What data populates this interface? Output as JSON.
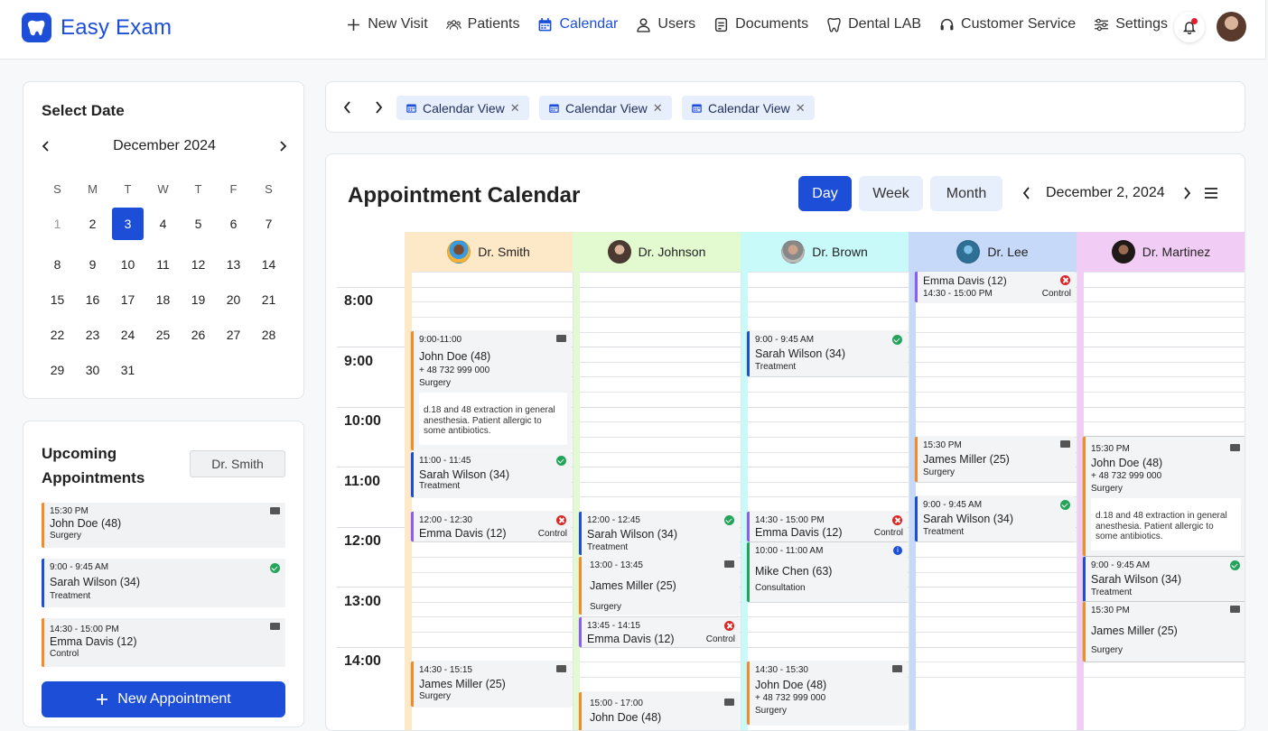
{
  "app": {
    "name": "Easy Exam"
  },
  "nav": [
    {
      "label": "New Visit",
      "icon": "plus-icon"
    },
    {
      "label": "Patients",
      "icon": "patients-icon"
    },
    {
      "label": "Calendar",
      "icon": "calendar-icon",
      "active": true
    },
    {
      "label": "Users",
      "icon": "user-icon"
    },
    {
      "label": "Documents",
      "icon": "document-icon"
    },
    {
      "label": "Dental LAB",
      "icon": "tooth-icon"
    },
    {
      "label": "Customer Service",
      "icon": "headset-icon"
    },
    {
      "label": "Settings",
      "icon": "sliders-icon"
    }
  ],
  "colors": {
    "accent": "#1d4ed8",
    "orange": "#f28c28",
    "blue": "#1d4ed8",
    "purple": "#8b5cf6",
    "green": "#22a559",
    "red": "#dc2626"
  },
  "date_picker": {
    "title": "Select Date",
    "month": "December 2024",
    "day_headers": [
      "S",
      "M",
      "T",
      "W",
      "T",
      "F",
      "S"
    ],
    "days": [
      "1",
      "2",
      "3",
      "4",
      "5",
      "6",
      "7",
      "8",
      "9",
      "10",
      "11",
      "12",
      "13",
      "14",
      "15",
      "16",
      "17",
      "18",
      "19",
      "20",
      "21",
      "22",
      "23",
      "24",
      "25",
      "26",
      "27",
      "28",
      "29",
      "30",
      "31"
    ],
    "selected": "3"
  },
  "upcoming": {
    "title": "Upcoming Appointments",
    "filter": "Dr. Smith",
    "items": [
      {
        "time": "15:30 PM",
        "name": "John Doe (48)",
        "type": "Surgery",
        "status": "mail"
      },
      {
        "time": "9:00 - 9:45 AM",
        "name": "Sarah Wilson (34)",
        "type": "Treatment",
        "status": "confirmed"
      },
      {
        "time": "14:30 - 15:00 PM",
        "name": "Emma Davis (12)",
        "type": "Control",
        "status": "mail"
      }
    ],
    "new_button": "New Appointment"
  },
  "tabs": [
    {
      "label": "Calendar View"
    },
    {
      "label": "Calendar View"
    },
    {
      "label": "Calendar View"
    }
  ],
  "calendar": {
    "title": "Appointment Calendar",
    "views": [
      "Day",
      "Week",
      "Month"
    ],
    "active_view": "Day",
    "date": "December 2, 2024",
    "hours": [
      "8:00",
      "9:00",
      "10:00",
      "11:00",
      "12:00",
      "13:00",
      "14:00"
    ],
    "doctors": [
      {
        "name": "Dr. Smith",
        "bg": "#fde9c7",
        "strip": "#fde9c7"
      },
      {
        "name": "Dr. Johnson",
        "bg": "#e3f9d0",
        "strip": "#e3f9d0"
      },
      {
        "name": "Dr. Brown",
        "bg": "#c9fafa",
        "strip": "#c9fafa"
      },
      {
        "name": "Dr. Lee",
        "bg": "#c6d9f8",
        "strip": "#c6d9f8"
      },
      {
        "name": "Dr. Martinez",
        "bg": "#f1cdf5",
        "strip": "#f1cdf5"
      }
    ],
    "events": {
      "smith_1": {
        "time": "9:00-11:00",
        "name": "John Doe (48)",
        "phone": "+ 48 732 999 000",
        "type": "Surgery",
        "note": "d.18 and 48 extraction in general anesthesia. Patient allergic to some antibiotics."
      },
      "smith_2": {
        "time": "11:00 - 11:45",
        "name": "Sarah Wilson (34)",
        "type": "Treatment"
      },
      "smith_3": {
        "time": "12:00 - 12:30",
        "name": "Emma Davis (12)",
        "type": "Control"
      },
      "smith_4": {
        "time": "14:30 - 15:15",
        "name": "James Miller (25)",
        "type": "Surgery"
      },
      "johnson_1": {
        "time": "12:00 - 12:45",
        "name": "Sarah Wilson (34)",
        "type": "Treatment"
      },
      "johnson_2": {
        "time": "13:00 - 13:45",
        "name": "James Miller (25)",
        "type": "Surgery"
      },
      "johnson_3": {
        "time": "13:45 - 14:15",
        "name": "Emma Davis (12)",
        "type": "Control"
      },
      "johnson_4": {
        "time": "15:00 - 17:00",
        "name": "John Doe (48)"
      },
      "brown_1": {
        "time": "9:00 - 9:45 AM",
        "name": "Sarah Wilson (34)",
        "type": "Treatment"
      },
      "brown_2": {
        "time": "14:30 - 15:00 PM",
        "name": "Emma Davis (12)",
        "type": "Control"
      },
      "brown_3": {
        "time": "10:00 - 11:00 AM",
        "name": "Mike Chen (63)",
        "type": "Consultation"
      },
      "brown_4": {
        "time": "14:30 - 15:30",
        "name": "John Doe (48)",
        "phone": "+ 48 732 999 000",
        "type": "Surgery"
      },
      "lee_1": {
        "name": "Emma Davis (12)",
        "time": "14:30 - 15:00 PM",
        "type": "Control"
      },
      "lee_2": {
        "time": "15:30 PM",
        "name": "James Miller (25)",
        "type": "Surgery"
      },
      "lee_3": {
        "time": "9:00 - 9:45 AM",
        "name": "Sarah Wilson (34)",
        "type": "Treatment"
      },
      "martinez_1": {
        "time": "15:30 PM",
        "name": "John Doe (48)",
        "phone": "+ 48 732 999 000",
        "type": "Surgery",
        "note": "d.18 and 48 extraction in general anesthesia. Patient allergic to some antibiotics."
      },
      "martinez_2": {
        "time": "9:00 - 9:45 AM",
        "name": "Sarah Wilson (34)",
        "type": "Treatment"
      },
      "martinez_3": {
        "time": "15:30 PM",
        "name": "James Miller (25)",
        "type": "Surgery"
      }
    }
  }
}
